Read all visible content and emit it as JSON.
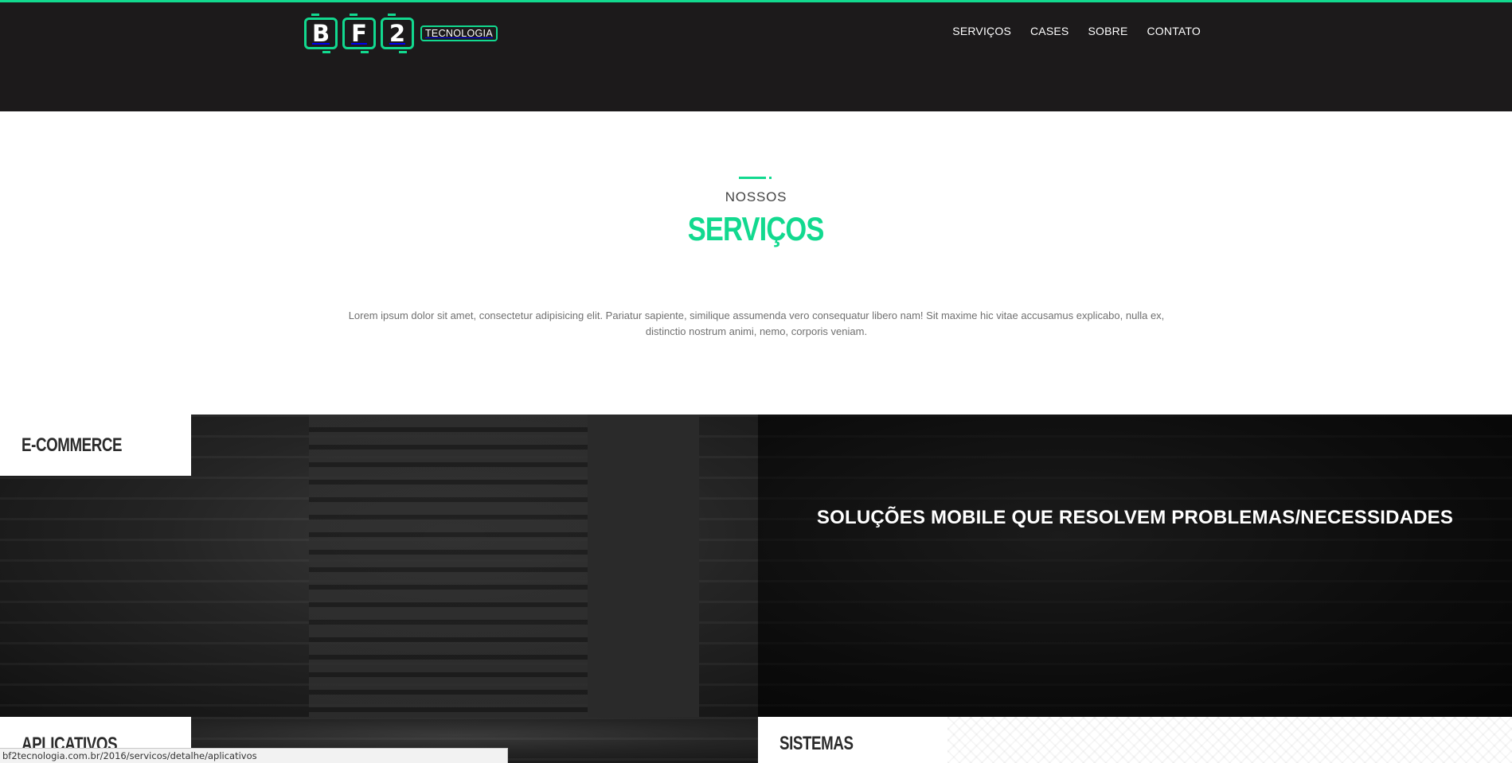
{
  "header": {
    "logo": {
      "letters": [
        "B",
        "F",
        "2"
      ],
      "tag": "TECNOLOGIA"
    },
    "nav": [
      {
        "label": "SERVIÇOS"
      },
      {
        "label": "CASES"
      },
      {
        "label": "SOBRE"
      },
      {
        "label": "CONTATO"
      }
    ]
  },
  "services_section": {
    "kicker": "NOSSOS",
    "title": "SERVIÇOS",
    "intro_line1": "Lorem ipsum dolor sit amet, consectetur adipisicing elit. Pariatur sapiente, similique assumenda vero consequatur libero nam! Sit maxime hic vitae accusamus explicabo, nulla ex,",
    "intro_line2": "distinctio nostrum animi, nemo, corporis veniam."
  },
  "tiles": {
    "ecommerce_label": "E-COMMERCE",
    "mobile_heading": "SOLUÇÕES MOBILE QUE RESOLVEM PROBLEMAS/NECESSIDADES",
    "apps_label": "APLICATIVOS",
    "systems_label": "SISTEMAS"
  },
  "statusbar": {
    "url": "bf2tecnologia.com.br/2016/servicos/detalhe/aplicativos"
  },
  "colors": {
    "accent": "#12d98f",
    "header_bg": "#1c1a1b",
    "text_dark": "#2b2b2b",
    "text_muted": "#707070"
  }
}
